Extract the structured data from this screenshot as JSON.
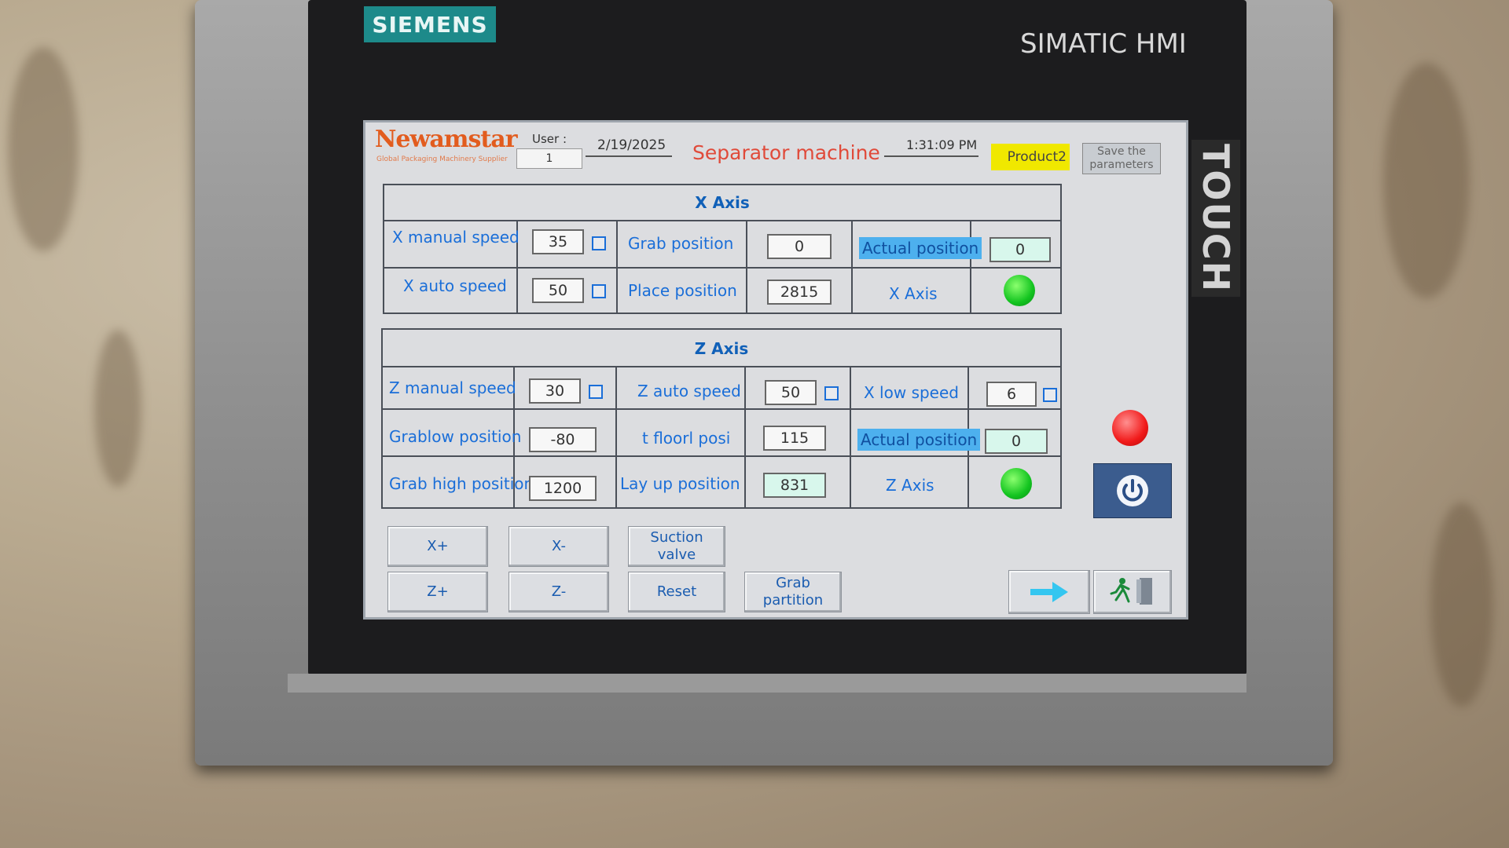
{
  "device": {
    "brand": "SIEMENS",
    "model": "SIMATIC HMI",
    "touch_label": "TOUCH"
  },
  "header": {
    "logo": "Newamstar",
    "logo_tagline": "Global Packaging Machinery Supplier",
    "user_label": "User :",
    "user_value": "1",
    "date": "2/19/2025",
    "title": "Separator machine",
    "time": "1:31:09 PM",
    "product": "Product2",
    "save_button": "Save the parameters"
  },
  "x_axis_panel": {
    "title": "X Axis",
    "x_manual_speed_label": "X manual speed",
    "x_manual_speed_value": "35",
    "grab_position_label": "Grab position",
    "grab_position_value": "0",
    "actual_position_label": "Actual position",
    "actual_position_value": "0",
    "x_auto_speed_label": "X auto speed",
    "x_auto_speed_value": "50",
    "place_position_label": "Place position",
    "place_position_value": "2815",
    "axis_status_label": "X Axis",
    "axis_status_color": "#13c420"
  },
  "z_axis_panel": {
    "title": "Z Axis",
    "z_manual_speed_label": "Z manual speed",
    "z_manual_speed_value": "30",
    "z_auto_speed_label": "Z auto speed",
    "z_auto_speed_value": "50",
    "x_low_speed_label": "X low speed",
    "x_low_speed_value": "6",
    "grablow_position_label": "Grablow position",
    "grablow_position_value": "-80",
    "floor_posi_label": "t floorl posi",
    "floor_posi_value": "115",
    "actual_position_label": "Actual position",
    "actual_position_value": "0",
    "grab_high_position_label": "Grab high position",
    "grab_high_position_value": "1200",
    "lay_up_position_label": "Lay up position",
    "lay_up_position_value": "831",
    "axis_status_label": "Z Axis",
    "axis_status_color": "#13c420"
  },
  "controls": {
    "x_plus": "X+",
    "x_minus": "X-",
    "suction_valve": "Suction valve",
    "z_plus": "Z+",
    "z_minus": "Z-",
    "reset": "Reset",
    "grab_partition": "Grab partition"
  },
  "status": {
    "alarm_color": "#f11a1a"
  }
}
